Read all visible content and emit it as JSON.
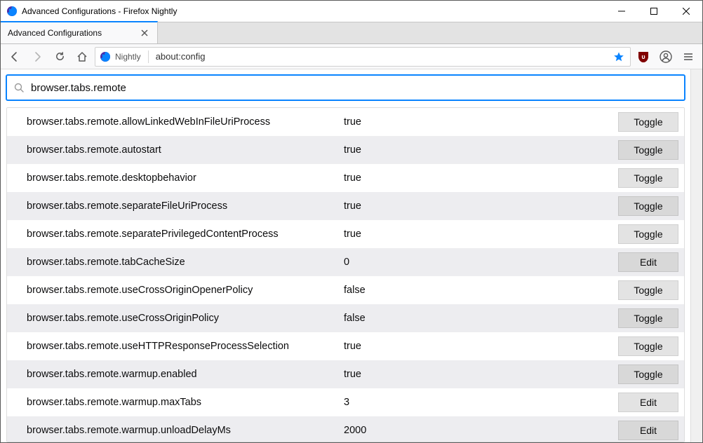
{
  "window": {
    "title": "Advanced Configurations - Firefox Nightly"
  },
  "tab": {
    "title": "Advanced Configurations"
  },
  "urlbar": {
    "identity_label": "Nightly",
    "url": "about:config"
  },
  "search": {
    "value": "browser.tabs.remote"
  },
  "buttons": {
    "toggle": "Toggle",
    "edit": "Edit"
  },
  "prefs": [
    {
      "name": "browser.tabs.remote.allowLinkedWebInFileUriProcess",
      "value": "true",
      "action": "toggle"
    },
    {
      "name": "browser.tabs.remote.autostart",
      "value": "true",
      "action": "toggle"
    },
    {
      "name": "browser.tabs.remote.desktopbehavior",
      "value": "true",
      "action": "toggle"
    },
    {
      "name": "browser.tabs.remote.separateFileUriProcess",
      "value": "true",
      "action": "toggle"
    },
    {
      "name": "browser.tabs.remote.separatePrivilegedContentProcess",
      "value": "true",
      "action": "toggle"
    },
    {
      "name": "browser.tabs.remote.tabCacheSize",
      "value": "0",
      "action": "edit"
    },
    {
      "name": "browser.tabs.remote.useCrossOriginOpenerPolicy",
      "value": "false",
      "action": "toggle"
    },
    {
      "name": "browser.tabs.remote.useCrossOriginPolicy",
      "value": "false",
      "action": "toggle"
    },
    {
      "name": "browser.tabs.remote.useHTTPResponseProcessSelection",
      "value": "true",
      "action": "toggle"
    },
    {
      "name": "browser.tabs.remote.warmup.enabled",
      "value": "true",
      "action": "toggle"
    },
    {
      "name": "browser.tabs.remote.warmup.maxTabs",
      "value": "3",
      "action": "edit"
    },
    {
      "name": "browser.tabs.remote.warmup.unloadDelayMs",
      "value": "2000",
      "action": "edit"
    }
  ]
}
